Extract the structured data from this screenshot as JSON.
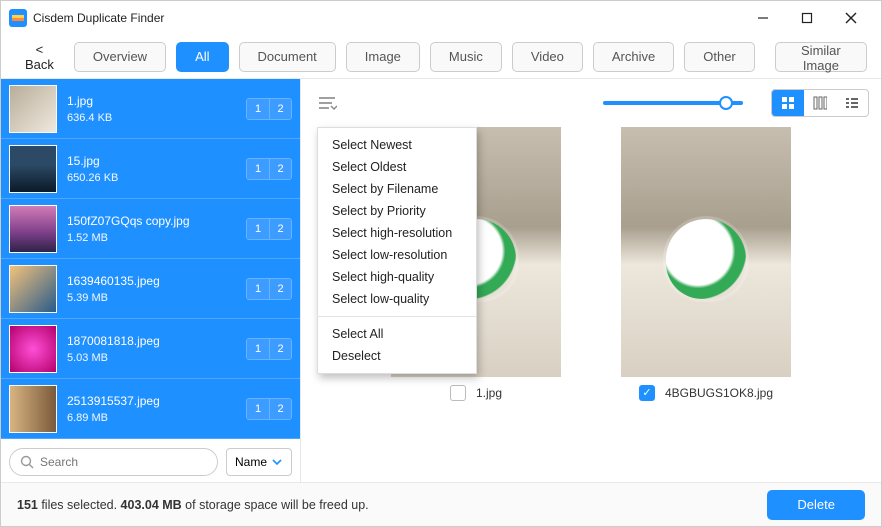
{
  "app": {
    "title": "Cisdem Duplicate Finder"
  },
  "toolbar": {
    "back": "< Back",
    "overview": "Overview",
    "tabs": [
      "All",
      "Document",
      "Image",
      "Music",
      "Video",
      "Archive",
      "Other"
    ],
    "active_tab_index": 0,
    "similar_image": "Similar Image"
  },
  "sidebar": {
    "files": [
      {
        "name": "1.jpg",
        "size": "636.4 KB",
        "badges": [
          "1",
          "2"
        ],
        "thumb": "t1"
      },
      {
        "name": "15.jpg",
        "size": "650.26 KB",
        "badges": [
          "1",
          "2"
        ],
        "thumb": "t2"
      },
      {
        "name": "150fZ07GQqs copy.jpg",
        "size": "1.52 MB",
        "badges": [
          "1",
          "2"
        ],
        "thumb": "t3"
      },
      {
        "name": "1639460135.jpeg",
        "size": "5.39 MB",
        "badges": [
          "1",
          "2"
        ],
        "thumb": "t4"
      },
      {
        "name": "1870081818.jpeg",
        "size": "5.03 MB",
        "badges": [
          "1",
          "2"
        ],
        "thumb": "t5"
      },
      {
        "name": "2513915537.jpeg",
        "size": "6.89 MB",
        "badges": [
          "1",
          "2"
        ],
        "thumb": "t6"
      }
    ],
    "search_placeholder": "Search",
    "sort_label": "Name"
  },
  "context_menu": {
    "items": [
      "Select Newest",
      "Select Oldest",
      "Select by Filename",
      "Select by Priority",
      "Select high-resolution",
      "Select low-resolution",
      "Select high-quality",
      "Select low-quality",
      "Select All",
      "Deselect"
    ],
    "separator_after_index": 7
  },
  "preview": {
    "images": [
      {
        "caption": "1.jpg",
        "checked": false
      },
      {
        "caption": "4BGBUGS1OK8.jpg",
        "checked": true
      }
    ]
  },
  "status": {
    "count": "151",
    "count_suffix": " files selected.  ",
    "size": "403.04 MB",
    "tail": "  of storage space will be freed up.",
    "delete": "Delete"
  }
}
